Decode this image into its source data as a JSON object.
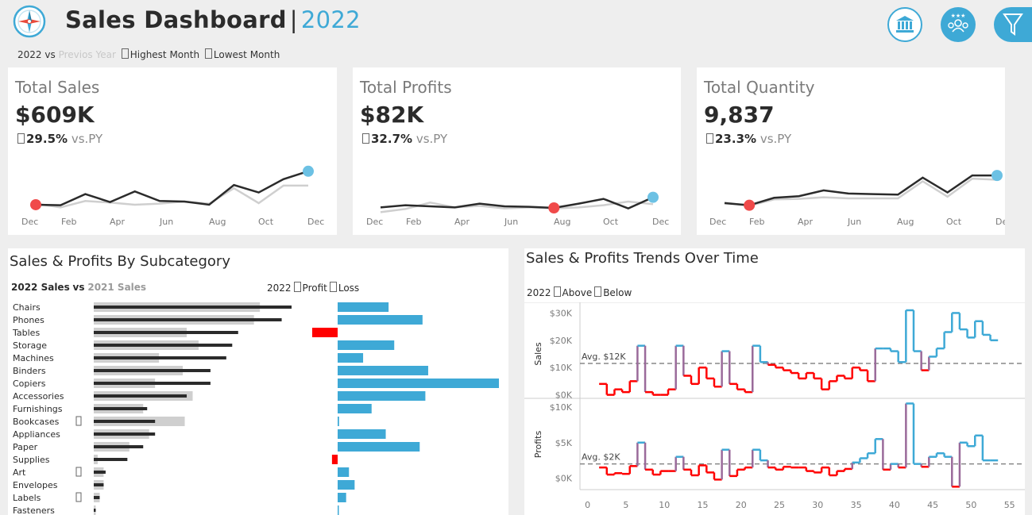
{
  "header": {
    "title": "Sales Dashboard",
    "separator": "|",
    "year": "2022",
    "legend": {
      "current": "2022",
      "vs": "vs",
      "previous": "Previos Year",
      "highest": "Highest Month",
      "lowest": "Lowest Month"
    },
    "buttons": [
      "bank-icon",
      "team-icon",
      "filter-icon"
    ]
  },
  "colors": {
    "accent": "#3ea9d6",
    "highlight_low": "#f04a4a",
    "current": "#2b2b2b",
    "previous": "#cfcfcf",
    "loss": "#ff0000"
  },
  "kpis": [
    {
      "label": "Total Sales",
      "value": "$609K",
      "delta": "29.5%",
      "vs": "vs.PY",
      "months": [
        "Dec",
        "Feb",
        "Apr",
        "Jun",
        "Aug",
        "Oct",
        "Dec"
      ],
      "chart_data": {
        "type": "line",
        "series": [
          {
            "values": [
              6,
              5,
              26,
              11,
              31,
              13,
              12,
              6,
              43,
              29,
              54,
              69
            ]
          },
          {
            "values": [
              8,
              1,
              13,
              10,
              6,
              8,
              12,
              8,
              37,
              9,
              42,
              42
            ]
          }
        ],
        "highlight_low": 0,
        "highlight_high": 11,
        "ylim": [
          0,
          100
        ]
      }
    },
    {
      "label": "Total Profits",
      "value": "$82K",
      "delta": "32.7%",
      "vs": "vs.PY",
      "months": [
        "Dec",
        "Feb",
        "Apr",
        "Jun",
        "Aug",
        "Oct",
        "Dec"
      ],
      "chart_data": {
        "type": "line",
        "series": [
          {
            "values": [
              1,
              5,
              3,
              1,
              8,
              3,
              2,
              0,
              8,
              17,
              -1,
              20
            ]
          },
          {
            "values": [
              -8,
              -2,
              10,
              1,
              4,
              -1,
              1,
              -1,
              1,
              5,
              12,
              7
            ]
          }
        ],
        "highlight_low": 7,
        "highlight_high": 11,
        "ylim": [
          0,
          100
        ]
      }
    },
    {
      "label": "Total Quantity",
      "value": "9,837",
      "delta": "23.3%",
      "vs": "vs.PY",
      "months": [
        "Dec",
        "Feb",
        "Apr",
        "Jun",
        "Aug",
        "Oct",
        "Dec"
      ],
      "chart_data": {
        "type": "line",
        "series": [
          {
            "values": [
              9,
              5,
              19,
              22,
              33,
              27,
              26,
              25,
              57,
              29,
              61,
              61
            ]
          },
          {
            "values": [
              10,
              4,
              16,
              17,
              20,
              18,
              18,
              18,
              50,
              21,
              55,
              53
            ]
          }
        ],
        "highlight_low": 1,
        "highlight_high": 11,
        "ylim": [
          0,
          100
        ]
      }
    }
  ],
  "subcategory": {
    "title": "Sales & Profits By Subcategory",
    "legend_sales": {
      "current": "2022 Sales",
      "vs": "vs",
      "previous": "2021 Sales"
    },
    "legend_profit": {
      "year": "2022",
      "profit": "Profit",
      "loss": "Loss"
    },
    "chart_data": {
      "type": "bar",
      "categories": [
        "Chairs",
        "Phones",
        "Tables",
        "Storage",
        "Machines",
        "Binders",
        "Copiers",
        "Accessories",
        "Furnishings",
        "Bookcases",
        "Appliances",
        "Paper",
        "Supplies",
        "Art",
        "Envelopes",
        "Labels",
        "Fasteners"
      ],
      "series": [
        {
          "name": "2022 Sales",
          "values": [
            100,
            95,
            73,
            70,
            67,
            59,
            59,
            47,
            27,
            31,
            31,
            25,
            17,
            6,
            5,
            3,
            1
          ]
        },
        {
          "name": "2021 Sales",
          "values": [
            84,
            81,
            47,
            53,
            33,
            45,
            31,
            50,
            25,
            46,
            28,
            18,
            2,
            5,
            5,
            3,
            1
          ]
        },
        {
          "name": "Profit",
          "values": [
            18,
            30,
            -9,
            20,
            9,
            32,
            57,
            31,
            12,
            0.5,
            17,
            29,
            -2,
            4,
            6,
            3,
            0.3
          ]
        }
      ],
      "flags": [
        false,
        false,
        false,
        false,
        false,
        false,
        false,
        false,
        false,
        true,
        false,
        false,
        false,
        true,
        false,
        true,
        false
      ]
    }
  },
  "trend": {
    "title": "Sales & Profits Trends Over Time",
    "legend": {
      "year": "2022",
      "above": "Above",
      "below": "Below"
    },
    "chart_data": {
      "type": "line",
      "x_ticks": [
        "0",
        "5",
        "10",
        "15",
        "20",
        "25",
        "30",
        "35",
        "40",
        "45",
        "50",
        "55"
      ],
      "xlim": [
        -1,
        57
      ],
      "sales": {
        "ylabel": "Sales",
        "y_ticks": [
          "$0K",
          "$10K",
          "$20K",
          "$30K"
        ],
        "ylim": [
          -1,
          31
        ],
        "avg_label": "Avg. $12K",
        "avg": 11.5,
        "values": [
          null,
          null,
          4,
          0,
          2,
          1,
          5,
          18,
          1,
          0,
          0,
          2,
          18,
          7,
          4,
          10,
          6,
          3,
          16,
          4,
          2,
          1,
          18,
          12,
          11,
          10,
          9,
          8,
          6,
          8,
          6,
          2,
          5,
          7,
          6,
          10,
          9,
          5,
          17,
          17,
          16,
          12,
          31,
          16,
          9,
          14,
          17,
          23,
          30,
          24,
          21,
          27,
          22,
          20
        ]
      },
      "profits": {
        "ylabel": "Profits",
        "y_ticks": [
          "$0K",
          "$5K",
          "$10K"
        ],
        "ylim": [
          -1.5,
          11
        ],
        "avg_label": "Avg. $2K",
        "avg": 2,
        "values": [
          null,
          null,
          1.5,
          0.5,
          0.7,
          0.6,
          1.7,
          5,
          1.2,
          0.5,
          1,
          1,
          3,
          1.2,
          0.4,
          1.8,
          0.8,
          -0.2,
          4,
          0.3,
          1.2,
          1.5,
          4,
          2.5,
          1.5,
          1.2,
          1.6,
          1.5,
          1.5,
          1,
          0.8,
          1.5,
          0.4,
          1,
          1.3,
          2.2,
          2.8,
          3.5,
          5.5,
          1.2,
          2,
          1.5,
          10.5,
          2,
          1.6,
          3,
          3.5,
          3,
          -1.2,
          5,
          4.5,
          6,
          2.5,
          2.5
        ]
      }
    }
  }
}
